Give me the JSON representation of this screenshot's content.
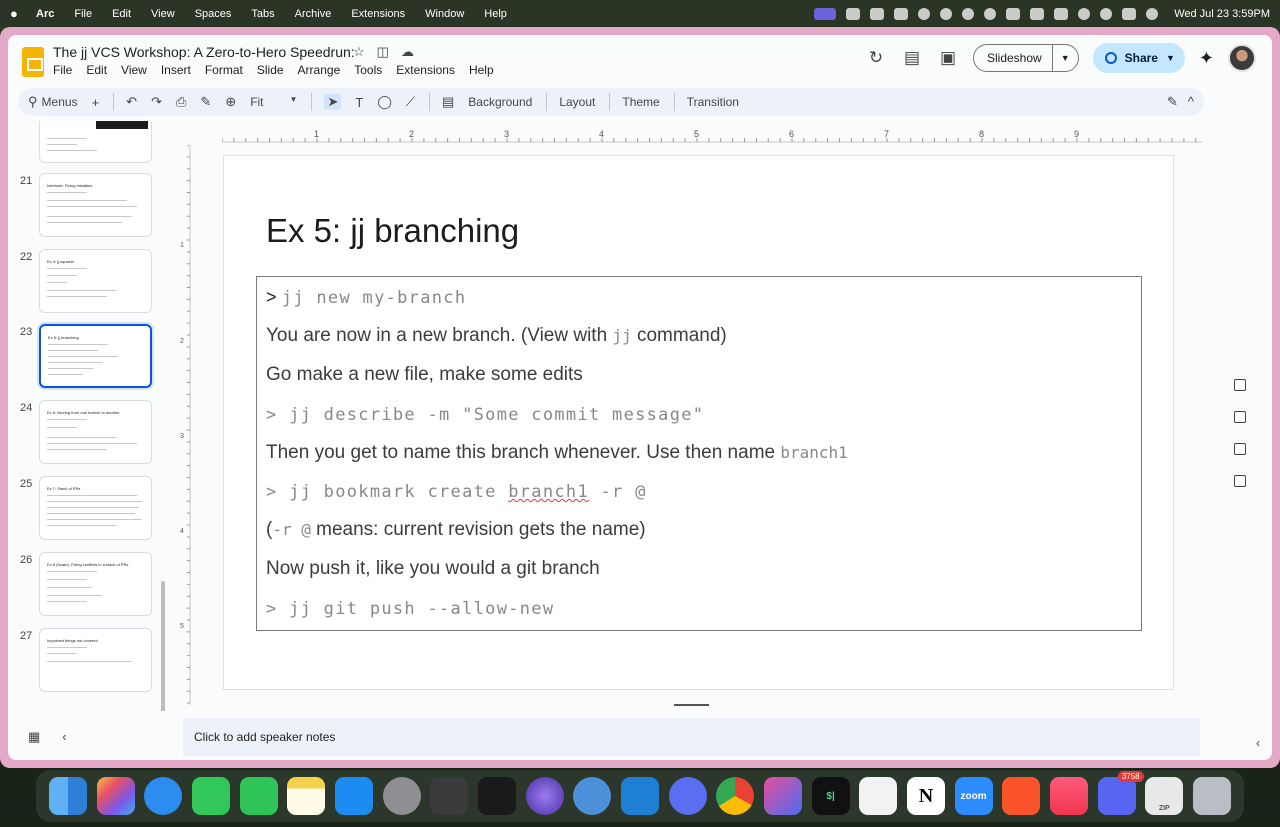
{
  "menubar": {
    "app_name": "Arc",
    "items": [
      "File",
      "Edit",
      "View",
      "Spaces",
      "Tabs",
      "Archive",
      "Extensions",
      "Window",
      "Help"
    ],
    "clock": "Wed Jul 23  3:59PM"
  },
  "doc": {
    "title": "The jj VCS Workshop: A Zero-to-Hero Speedrun:",
    "menu": [
      "File",
      "Edit",
      "View",
      "Insert",
      "Format",
      "Slide",
      "Arrange",
      "Tools",
      "Extensions",
      "Help"
    ],
    "slideshow_label": "Slideshow",
    "share_label": "Share"
  },
  "toolbar": {
    "menus_label": "Menus",
    "zoom_value": "Fit",
    "background_label": "Background",
    "layout_label": "Layout",
    "theme_label": "Theme",
    "transition_label": "Transition"
  },
  "filmstrip": [
    {
      "num": "",
      "title": ""
    },
    {
      "num": "21",
      "title": "Interlude: Fixing mistakes"
    },
    {
      "num": "22",
      "title": "Ex 4: jj squash!"
    },
    {
      "num": "23",
      "title": "Ex 5: jj branching"
    },
    {
      "num": "24",
      "title": "Ex 6: Moving from one branch to another"
    },
    {
      "num": "25",
      "title": "Ex 7: Stack of PRs"
    },
    {
      "num": "26",
      "title": "Ex 8 (Scale): Fixing conflicts in a stack of PRs"
    },
    {
      "num": "27",
      "title": "Important things not covered"
    }
  ],
  "rulers": {
    "top": [
      "1",
      "2",
      "3",
      "4",
      "5",
      "6",
      "7",
      "8",
      "9"
    ],
    "left": [
      "1",
      "2",
      "3",
      "4",
      "5"
    ]
  },
  "slide": {
    "title": "Ex 5: jj branching",
    "line1_prompt": ">",
    "line1_cmd": "jj new my-branch",
    "line2_a": "You are now in a new branch.  (View with ",
    "line2_code": "jj",
    "line2_b": " command)",
    "line3": "Go make a new file, make some edits",
    "line4_cmd": "> jj describe -m \"Some commit message\"",
    "line5_a": "Then you get to name this branch whenever. Use then name ",
    "line5_code": "branch1",
    "line6_a": "> jj bookmark create ",
    "line6_b": "branch1",
    "line6_c": " -r @",
    "line7_open": "(",
    "line7_code": "-r @",
    "line7_rest": " means: current revision gets the name)",
    "line8": "Now push it, like you would a git branch",
    "line9_cmd": "> jj git push --allow-new"
  },
  "notes": {
    "placeholder": "Click to add speaker notes"
  },
  "dock": {
    "icons": [
      "finder",
      "launchpad",
      "safari",
      "messages",
      "facetime",
      "notes",
      "app-store",
      "system-settings",
      "layers",
      "cursor",
      "orb",
      "proxyman",
      "vscode",
      "chat",
      "chrome",
      "affinity",
      "terminal",
      "script-editor",
      "notion",
      "zoom",
      "brave",
      "music",
      "discord",
      "zip-file",
      "trash"
    ],
    "discord_badge": "3758",
    "zoom_label": "zoom",
    "terminal_label": "$|",
    "notion_label": "N",
    "zip_label": "ZIP"
  }
}
